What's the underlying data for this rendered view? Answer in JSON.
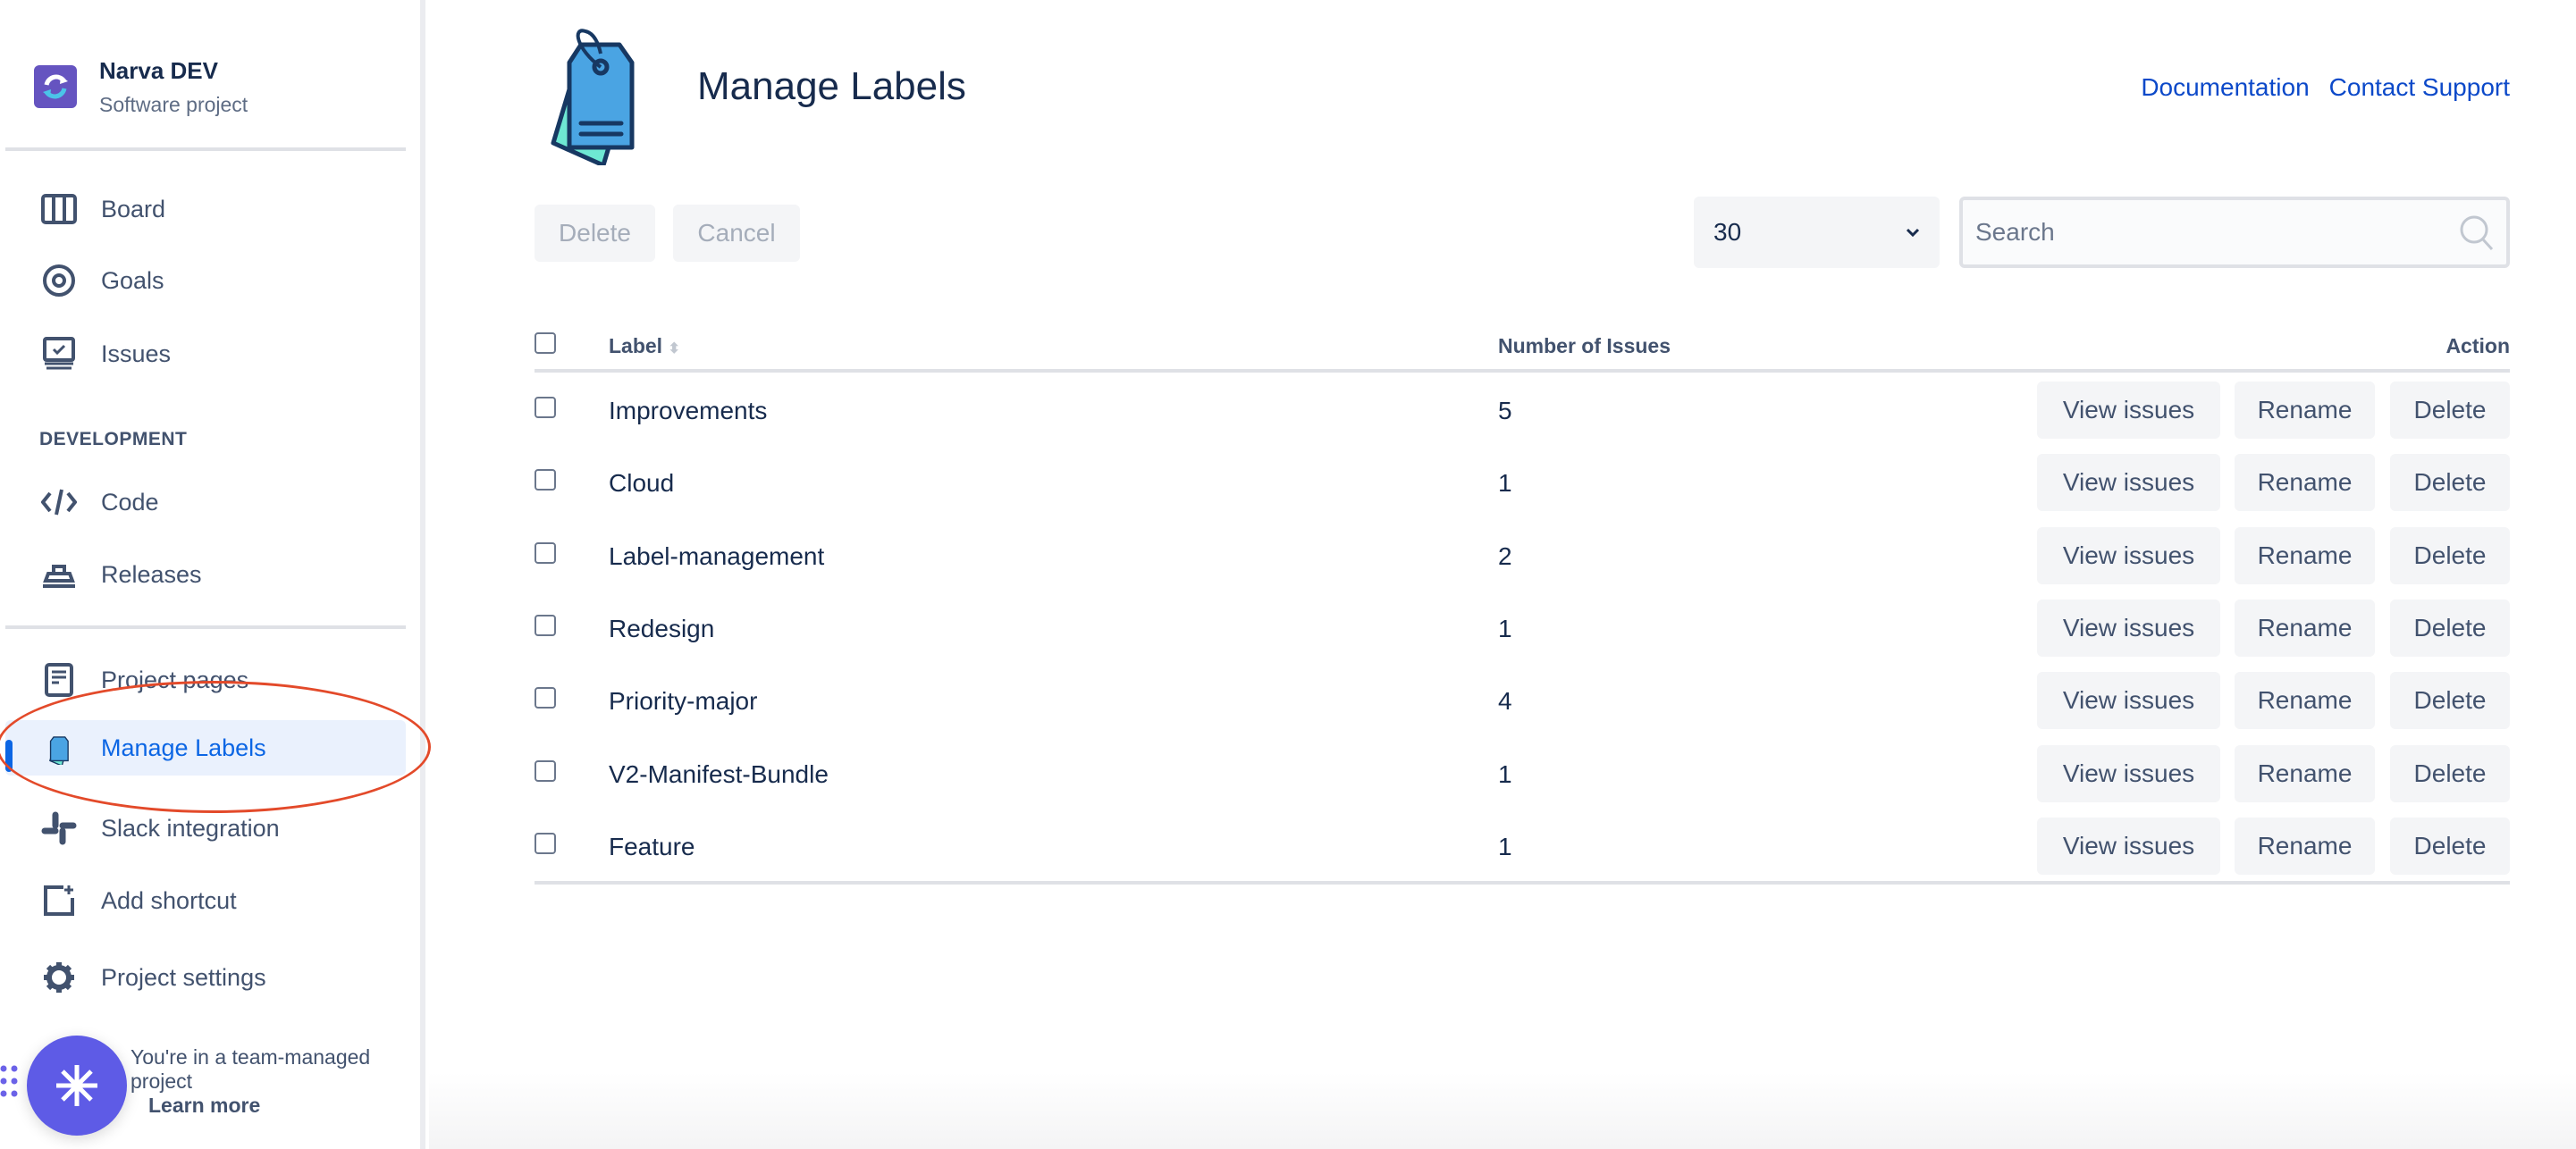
{
  "project": {
    "name": "Narva DEV",
    "type": "Software project"
  },
  "sidebar": {
    "items": [
      {
        "label": "Board",
        "icon": "board-icon"
      },
      {
        "label": "Goals",
        "icon": "goals-icon"
      },
      {
        "label": "Issues",
        "icon": "issues-icon"
      }
    ],
    "section": "DEVELOPMENT",
    "dev_items": [
      {
        "label": "Code",
        "icon": "code-icon"
      },
      {
        "label": "Releases",
        "icon": "releases-icon"
      }
    ],
    "bottom_items": [
      {
        "label": "Project pages",
        "icon": "pages-icon"
      },
      {
        "label": "Manage Labels",
        "icon": "tag-icon",
        "active": true
      },
      {
        "label": "Slack integration",
        "icon": "slack-icon"
      },
      {
        "label": "Add shortcut",
        "icon": "add-shortcut-icon"
      },
      {
        "label": "Project settings",
        "icon": "gear-icon"
      }
    ],
    "footer_text": "You're in a team-managed project",
    "learn_more": "Learn more"
  },
  "header": {
    "title": "Manage Labels",
    "links": [
      "Documentation",
      "Contact Support"
    ]
  },
  "toolbar": {
    "delete": "Delete",
    "cancel": "Cancel",
    "page_size": "30",
    "search_placeholder": "Search"
  },
  "table": {
    "columns": [
      "Label",
      "Number of Issues",
      "Action"
    ],
    "actions": [
      "View issues",
      "Rename",
      "Delete"
    ],
    "rows": [
      {
        "label": "Improvements",
        "count": "5"
      },
      {
        "label": "Cloud",
        "count": "1"
      },
      {
        "label": "Label-management",
        "count": "2"
      },
      {
        "label": "Redesign",
        "count": "1"
      },
      {
        "label": "Priority-major",
        "count": "4"
      },
      {
        "label": "V2-Manifest-Bundle",
        "count": "1"
      },
      {
        "label": "Feature",
        "count": "1"
      }
    ]
  },
  "colors": {
    "accent": "#0C66E4",
    "link": "#0C49C9",
    "highlight": "#E34A2A",
    "fab": "#5E5BE6"
  }
}
